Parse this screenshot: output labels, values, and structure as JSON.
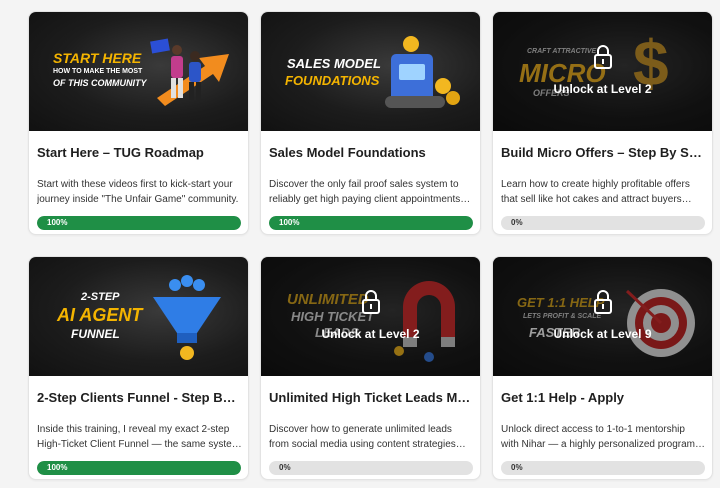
{
  "courses": [
    {
      "title": "Start Here – TUG Roadmap",
      "desc_lines": [
        "Start with these videos first to kick-start your",
        "journey inside \"The Unfair Game\" community."
      ],
      "progress": 100,
      "progress_label": "100%",
      "thumb": {
        "line1": "START HERE",
        "line2": "HOW TO MAKE THE MOST",
        "line3": "OF THIS COMMUNITY"
      },
      "locked": false
    },
    {
      "title": "Sales Model Foundations",
      "desc_lines": [
        "Discover the only fail proof sales system to",
        "reliably get high paying client appointments…"
      ],
      "progress": 100,
      "progress_label": "100%",
      "thumb": {
        "line1": "SALES MODEL",
        "line2": "FOUNDATIONS"
      },
      "locked": false
    },
    {
      "title": "Build Micro Offers – Step By Step …",
      "desc_lines": [
        "Learn how to create highly profitable offers",
        "that sell like hot cakes and attract buyers…"
      ],
      "progress": 0,
      "progress_label": "0%",
      "thumb": {
        "line1": "CRAFT ATTRACTIVE",
        "line2": "MICRO",
        "line3": "OFFERS"
      },
      "locked": true,
      "lock_label": "Unlock at Level 2"
    },
    {
      "title": "2-Step Clients Funnel - Step By St…",
      "desc_lines": [
        "Inside this training, I reveal my exact 2-step",
        "High-Ticket Client Funnel — the same syste…"
      ],
      "progress": 100,
      "progress_label": "100%",
      "thumb": {
        "line1": "2-STEP",
        "line2": "AI AGENT",
        "line3": "FUNNEL"
      },
      "locked": false
    },
    {
      "title": "Unlimited High Ticket Leads Mac…",
      "desc_lines": [
        "Discover how to generate unlimited leads",
        "from social media using content strategies…"
      ],
      "progress": 0,
      "progress_label": "0%",
      "thumb": {
        "line1": "UNLIMITED",
        "line2": "HIGH TICKET",
        "line3": "LEADS"
      },
      "locked": true,
      "lock_label": "Unlock at Level 2"
    },
    {
      "title": "Get 1:1 Help - Apply",
      "desc_lines": [
        "Unlock direct access to 1-to-1 mentorship",
        "with Nihar — a highly personalized program…"
      ],
      "progress": 0,
      "progress_label": "0%",
      "thumb": {
        "line1": "GET 1:1 HELP",
        "line2": "LETS PROFIT & SCALE",
        "line3": "FASTER"
      },
      "locked": true,
      "lock_label": "Unlock at Level 9"
    }
  ],
  "colors": {
    "progress_fill": "#1f8f46",
    "progress_track": "#e2e2e2",
    "thumb_gold": "#f0b323",
    "thumb_bg": "#1c1c1c"
  }
}
